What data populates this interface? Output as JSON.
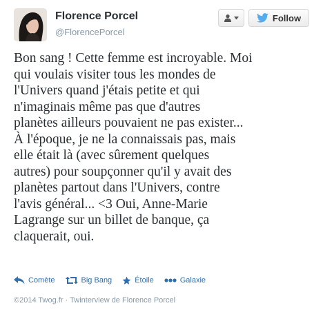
{
  "author": {
    "name": "Florence Porcel",
    "handle": "@FlorencePorcel"
  },
  "buttons": {
    "follow_label": "Follow"
  },
  "tweet": {
    "text": "Bon sang ! Cette femme est incroyable. Moi\nqui voulais visiter tous les mondes de\nl'Univers quand j'étais petite et qui\nn'imaginais même pas que d'autres\nplanètes ailleurs pouvaient ne pas exister...\nÀ l'époque, je ne la connaissais pas, mais\nelle était là (avec sûrement quelques\nautres) pour soupçonner qu'il y avait des\nplanètes partout dans l'Univers, contre\nl'avis général... <3 Oui, Anne-Marie\nLagrange sur un billet de banque, ça\nclaquerait, oui."
  },
  "actions": {
    "reply_label": "Comète",
    "retweet_label": "Big Bang",
    "favorite_label": "Étoile",
    "more_label": "Galaxie"
  },
  "footer": {
    "copyright": "©2014 Twog.fr",
    "separator": "·",
    "credit": "Twinterview de Florence Porcel"
  },
  "colors": {
    "action_blue": "#2f6fad",
    "twitter_blue": "#55acee",
    "muted": "#8899a6"
  },
  "icons": {
    "avatar": "profile-photo",
    "user_menu": "user-dropdown-icon",
    "follow": "twitter-bird-icon",
    "reply": "reply-arrow-icon",
    "retweet": "retweet-icon",
    "favorite": "star-icon",
    "more": "more-dots-icon"
  }
}
